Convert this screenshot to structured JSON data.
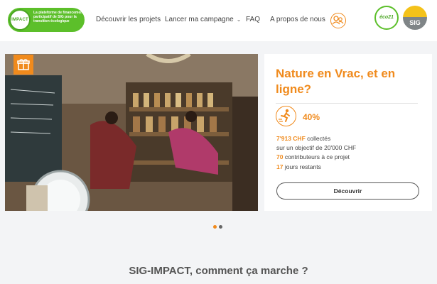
{
  "header": {
    "logo": {
      "name": "IMPACT",
      "tagline": "La plateforme de financement participatif de SIG pour la transition écologique"
    },
    "nav": [
      {
        "label": "Découvrir les projets"
      },
      {
        "label": "Lancer ma campagne"
      },
      {
        "label": "FAQ"
      },
      {
        "label": "A propos de nous"
      }
    ],
    "partner_logos": {
      "eco21": "éco21",
      "sig": "SIG"
    }
  },
  "campaign": {
    "title": "Nature en Vrac, et en ligne?",
    "progress_percent": "40%",
    "progress_value": 0.4,
    "collected_amount": "7'913 CHF",
    "collected_label": "collectés",
    "goal_text": "sur un objectif de 20'000 CHF",
    "contributors_count": "70",
    "contributors_label": "contributeurs à ce projet",
    "days_count": "17",
    "days_label": "jours restants",
    "cta": "Découvrir"
  },
  "carousel": {
    "slides": 2,
    "active": 1
  },
  "section": {
    "title": "SIG-IMPACT, comment ça marche ?"
  },
  "colors": {
    "accent": "#f08a1c",
    "brand_green": "#5cbf2a",
    "sig_yellow": "#f4c21a",
    "sig_grey": "#7f8587"
  },
  "icons": {
    "gift": "gift-icon",
    "user": "user-circle-icon",
    "runner": "runner-icon",
    "chevron": "chevron-down-icon"
  }
}
